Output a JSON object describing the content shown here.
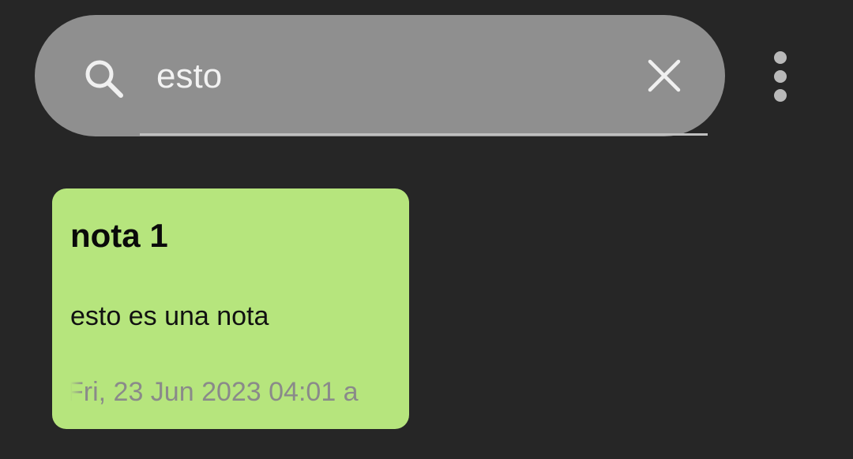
{
  "search": {
    "query": "esto",
    "icon": "search-icon",
    "clear_icon": "close-icon"
  },
  "toolbar": {
    "menu_icon": "more-vertical-icon"
  },
  "notes": [
    {
      "title": "nota 1",
      "body": "esto es una nota",
      "date": "Fri, 23 Jun 2023 04:01 a",
      "color": "#b6e57d"
    }
  ],
  "colors": {
    "background": "#262626",
    "search_bar": "#8f8f8f",
    "note_green": "#b6e57d",
    "date_text": "#8a8a8a"
  }
}
